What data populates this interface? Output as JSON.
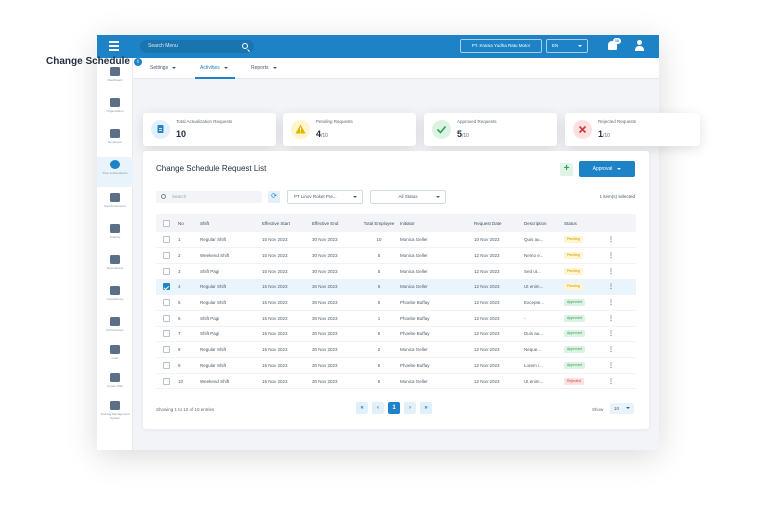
{
  "topbar": {
    "search_placeholder": "Search Menu",
    "company": "PT. Krama Yudha Ratu Motor",
    "language": "EN",
    "notification_count": "10"
  },
  "sidebar": {
    "items": [
      {
        "label": "Dashboard"
      },
      {
        "label": "Organization"
      },
      {
        "label": "Employee"
      },
      {
        "label": "Time & Attendance"
      },
      {
        "label": "Reimbursement"
      },
      {
        "label": "Training"
      },
      {
        "label": "Recruitment"
      },
      {
        "label": "Competency"
      },
      {
        "label": "Performance"
      },
      {
        "label": "Loan"
      },
      {
        "label": "Career Plan"
      },
      {
        "label": "Training Management System"
      }
    ]
  },
  "subnav": {
    "settings": "Settings",
    "activities": "Activities",
    "reports": "Reports"
  },
  "page": {
    "title": "Change Schedule",
    "info": "i"
  },
  "stats": [
    {
      "title": "Total Actualization Requests",
      "value": "10",
      "suffix": ""
    },
    {
      "title": "Pending Requests",
      "value": "4",
      "suffix": "/10"
    },
    {
      "title": "Approved Requests",
      "value": "5",
      "suffix": "/10"
    },
    {
      "title": "Rejected Requests",
      "value": "1",
      "suffix": "/10"
    }
  ],
  "card": {
    "title": "Change Schedule Request List",
    "plus": "+",
    "approval_label": "Approval",
    "search_placeholder": "Search",
    "refresh": "⟳",
    "company_filter": "PT Linov Roket Pre...",
    "status_filter": "All Status",
    "selected_text": "1 item(s) selected"
  },
  "table": {
    "headers": [
      "No",
      "Shift",
      "Effective Start",
      "Effective End",
      "Total Employee",
      "Initiator",
      "Request Date",
      "Description",
      "Status"
    ],
    "rows": [
      {
        "no": "1",
        "shift": "Regular Shift",
        "start": "15 Nov 2023",
        "end": "30 Nov 2023",
        "total": "10",
        "initiator": "Monica Geller",
        "date": "10 Nov 2023",
        "desc": "Quis au...",
        "status": "Pending"
      },
      {
        "no": "2",
        "shift": "Weekend Shift",
        "start": "15 Nov 2023",
        "end": "30 Nov 2023",
        "total": "5",
        "initiator": "Monica Geller",
        "date": "12 Nov 2023",
        "desc": "Nemo e...",
        "status": "Pending"
      },
      {
        "no": "3",
        "shift": "Shift Pagi",
        "start": "15 Nov 2023",
        "end": "30 Nov 2023",
        "total": "5",
        "initiator": "Monica Geller",
        "date": "12 Nov 2023",
        "desc": "Sed ut...",
        "status": "Pending"
      },
      {
        "no": "4",
        "shift": "Regular Shift",
        "start": "15 Nov 2023",
        "end": "30 Nov 2023",
        "total": "5",
        "initiator": "Monica Geller",
        "date": "12 Nov 2023",
        "desc": "Ut enim...",
        "status": "Pending"
      },
      {
        "no": "5",
        "shift": "Regular Shift",
        "start": "15 Nov 2023",
        "end": "30 Nov 2023",
        "total": "5",
        "initiator": "Phoebe Buffay",
        "date": "12 Nov 2023",
        "desc": "Excepte...",
        "status": "Approved"
      },
      {
        "no": "6",
        "shift": "Shift Pagi",
        "start": "15 Nov 2023",
        "end": "30 Nov 2023",
        "total": "1",
        "initiator": "Phoebe Buffay",
        "date": "12 Nov 2023",
        "desc": "-",
        "status": "Approved"
      },
      {
        "no": "7",
        "shift": "Shift Pagi",
        "start": "15 Nov 2023",
        "end": "30 Nov 2023",
        "total": "5",
        "initiator": "Phoebe Buffay",
        "date": "12 Nov 2023",
        "desc": "Duis au...",
        "status": "Approved"
      },
      {
        "no": "8",
        "shift": "Regular Shift",
        "start": "15 Nov 2023",
        "end": "30 Nov 2023",
        "total": "2",
        "initiator": "Monica Geller",
        "date": "12 Nov 2023",
        "desc": "Neque...",
        "status": "Approved"
      },
      {
        "no": "9",
        "shift": "Regular Shift",
        "start": "15 Nov 2023",
        "end": "30 Nov 2023",
        "total": "5",
        "initiator": "Phoebe Buffay",
        "date": "12 Nov 2023",
        "desc": "Lorem i...",
        "status": "Approved"
      },
      {
        "no": "10",
        "shift": "Weekend Shift",
        "start": "15 Nov 2023",
        "end": "30 Nov 2023",
        "total": "5",
        "initiator": "Monica Geller",
        "date": "12 Nov 2023",
        "desc": "Ut enim...",
        "status": "Rejected"
      }
    ],
    "selected_row": 4
  },
  "footer": {
    "showing": "Showing 1 to 10 of 10 entries",
    "first": "«",
    "prev": "‹",
    "page": "1",
    "next": "›",
    "last": "»",
    "show_label": "Show",
    "show_value": "10"
  },
  "colors": {
    "primary": "#1d83c6",
    "pending": "#c79a00",
    "approved": "#2f9e55",
    "rejected": "#d33a3a"
  }
}
